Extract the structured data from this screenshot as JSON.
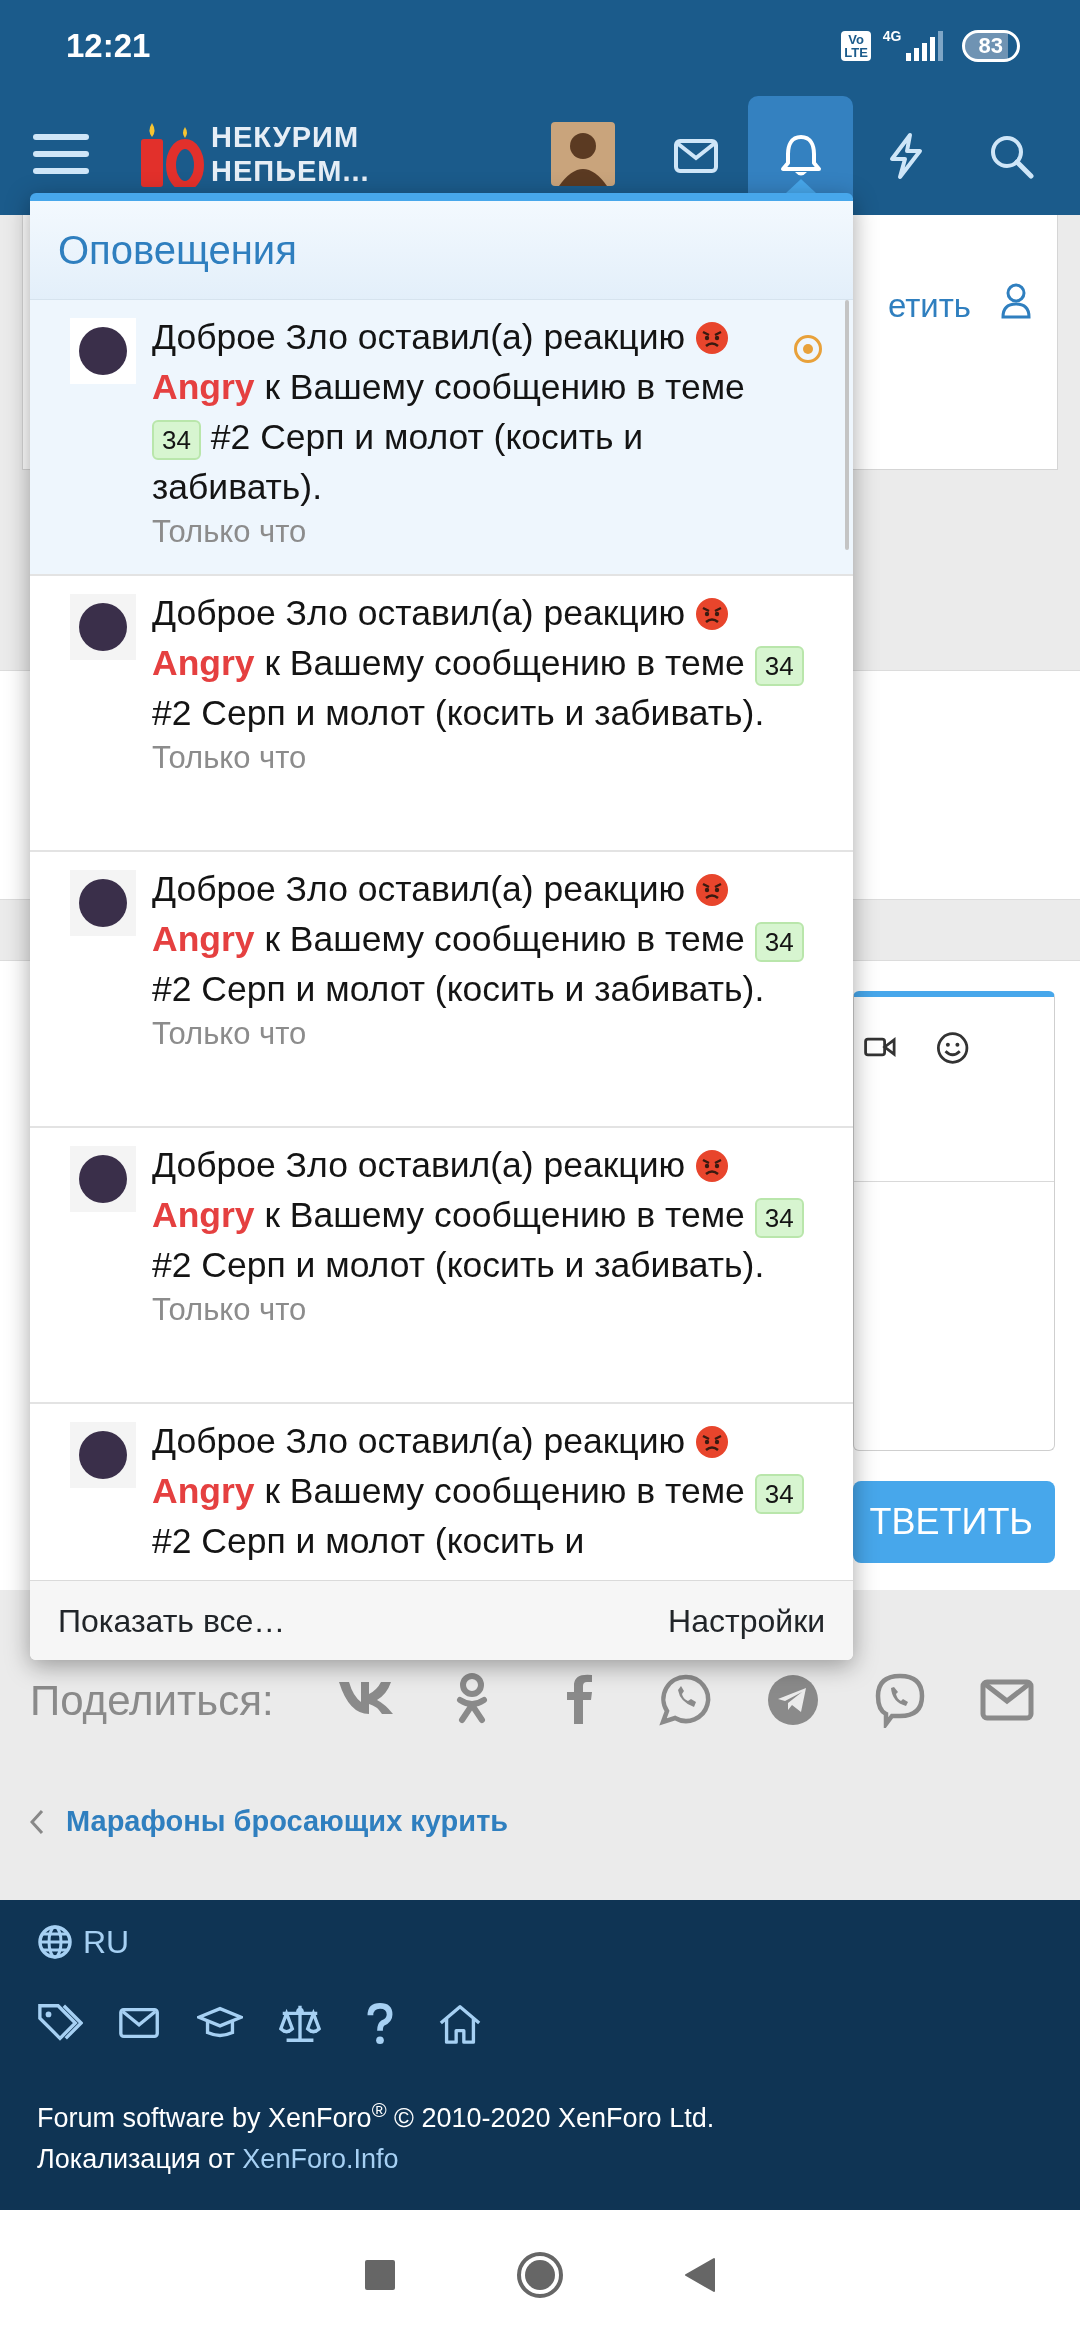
{
  "status_bar": {
    "time": "12:21",
    "volte_top": "Vo",
    "volte_bottom": "LTE",
    "network": "4G",
    "battery": "83"
  },
  "header": {
    "logo_lines": [
      "НЕКУРИМ",
      "НЕПЬЕМ..."
    ],
    "nav_tabs": [
      {
        "kind": "mail",
        "selected": false
      },
      {
        "kind": "bell",
        "selected": true
      },
      {
        "kind": "bolt",
        "selected": false
      },
      {
        "kind": "search",
        "selected": false
      }
    ]
  },
  "page": {
    "card_link": "етить",
    "reply_button": "ТВЕТИТЬ",
    "share_label": "Поделиться:",
    "breadcrumb": "Марафоны бросающих курить"
  },
  "popup": {
    "title": "Оповещения",
    "items": [
      {
        "user": "Доброе Зло",
        "action": "оставил(а) реакцию",
        "reaction": "Angry",
        "prep": "к",
        "link": "Вашему сообщению",
        "tail": "в теме",
        "badge": "34",
        "thread": "#2 Серп и молот (косить и забивать).",
        "time": "Только что",
        "unread": true
      },
      {
        "user": "Доброе Зло",
        "action": "оставил(а) реакцию",
        "reaction": "Angry",
        "prep": "к",
        "link": "Вашему сообщению",
        "tail": "в теме",
        "badge": "34",
        "thread": "#2 Серп и молот (косить и забивать).",
        "time": "Только что",
        "unread": false
      },
      {
        "user": "Доброе Зло",
        "action": "оставил(а) реакцию",
        "reaction": "Angry",
        "prep": "к",
        "link": "Вашему сообщению",
        "tail": "в теме",
        "badge": "34",
        "thread": "#2 Серп и молот (косить и забивать).",
        "time": "Только что",
        "unread": false
      },
      {
        "user": "Доброе Зло",
        "action": "оставил(а) реакцию",
        "reaction": "Angry",
        "prep": "к",
        "link": "Вашему сообщению",
        "tail": "в теме",
        "badge": "34",
        "thread": "#2 Серп и молот (косить и забивать).",
        "time": "Только что",
        "unread": false
      },
      {
        "user": "Доброе Зло",
        "action": "оставил(а) реакцию",
        "reaction": "Angry",
        "prep": "к",
        "link": "Вашему сообщению",
        "tail": "в теме",
        "badge": "34",
        "thread": "#2 Серп и молот (косить и",
        "unread": false
      }
    ],
    "show_all": "Показать все…",
    "settings": "Настройки"
  },
  "footer": {
    "language": "RU",
    "copyright": "Forum software by XenForo$^{®}$ © 2010-2020 XenForo Ltd.",
    "localization": "Локализация от",
    "localization_link": "XenForo.Info"
  }
}
